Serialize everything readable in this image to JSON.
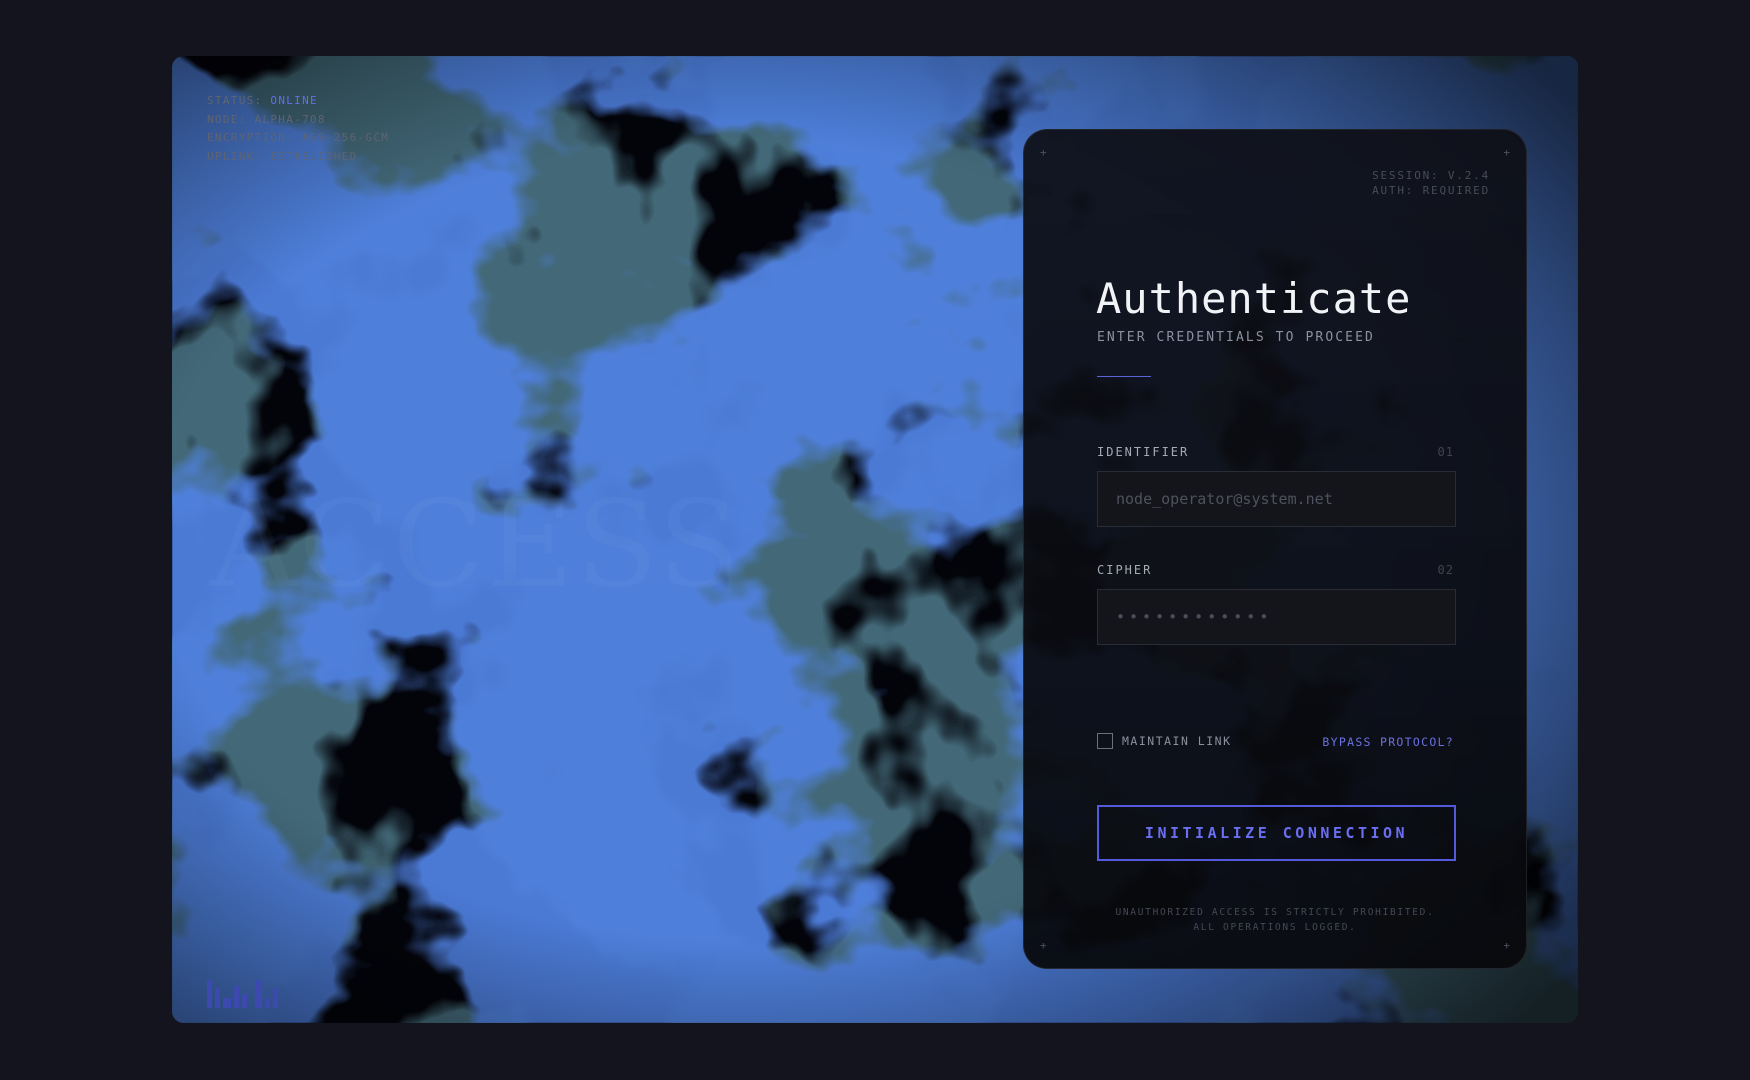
{
  "status": {
    "status_label": "STATUS:",
    "status_value": "ONLINE",
    "node": "NODE: ALPHA-708",
    "encryption": "ENCRYPTION: AES-256-GCM",
    "uplink": "UPLINK: ESTABLISHED"
  },
  "watermark": "ACCESS",
  "panel": {
    "corner_glyph": "+",
    "session": "SESSION: V.2.4",
    "auth": "AUTH: REQUIRED",
    "title": "Authenticate",
    "subtitle": "ENTER CREDENTIALS TO PROCEED",
    "identifier": {
      "label": "IDENTIFIER",
      "number": "01",
      "placeholder": "node_operator@system.net",
      "value": ""
    },
    "cipher": {
      "label": "CIPHER",
      "number": "02",
      "placeholder": "••••••••••••",
      "value": ""
    },
    "remember_label": "MAINTAIN LINK",
    "bypass_label": "BYPASS PROTOCOL?",
    "submit_label": "INITIALIZE CONNECTION",
    "footer_line1": "UNAUTHORIZED ACCESS IS STRICTLY PROHIBITED.",
    "footer_line2": "ALL OPERATIONS LOGGED."
  },
  "colors": {
    "accent": "#5a63d8",
    "online": "#6270e6",
    "background": "#13141e"
  },
  "icons": {
    "equalizer": "equalizer-bars-icon",
    "corner": "plus-corner-icon"
  }
}
